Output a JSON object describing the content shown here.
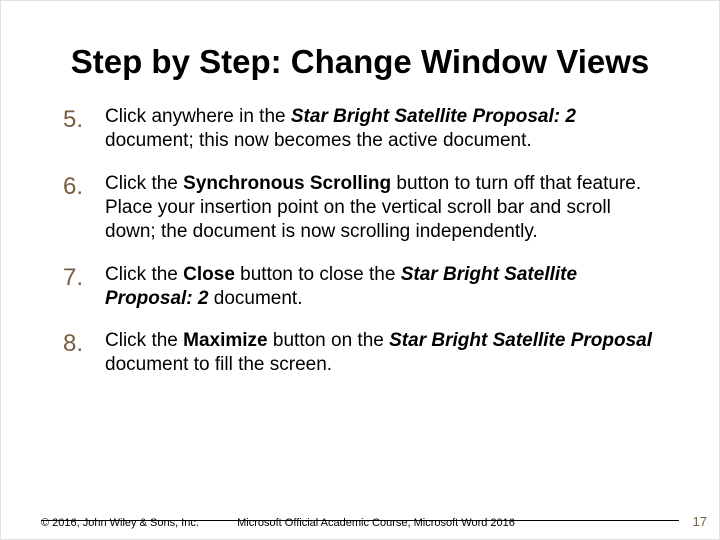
{
  "title": "Step by Step: Change Window Views",
  "steps": [
    {
      "num": "5.",
      "segments": [
        {
          "t": "Click anywhere in the "
        },
        {
          "t": "Star Bright Satellite Proposal: 2",
          "cls": "bolditalic"
        },
        {
          "t": " document; this now becomes the active document."
        }
      ]
    },
    {
      "num": "6.",
      "segments": [
        {
          "t": "Click the "
        },
        {
          "t": "Synchronous Scrolling",
          "cls": "bold"
        },
        {
          "t": " button to turn off that feature. Place your insertion point on the vertical scroll bar and scroll down; the document is now scrolling independently."
        }
      ]
    },
    {
      "num": "7.",
      "segments": [
        {
          "t": "Click the "
        },
        {
          "t": "Close",
          "cls": "bold"
        },
        {
          "t": " button to close the "
        },
        {
          "t": "Star Bright Satellite Proposal: 2",
          "cls": "bolditalic"
        },
        {
          "t": " document."
        }
      ]
    },
    {
      "num": "8.",
      "segments": [
        {
          "t": "Click the "
        },
        {
          "t": "Maximize",
          "cls": "bold"
        },
        {
          "t": " button on the "
        },
        {
          "t": "Star Bright Satellite Proposal",
          "cls": "bolditalic"
        },
        {
          "t": " document to fill the screen."
        }
      ]
    }
  ],
  "footer": {
    "copyright": "© 2016, John Wiley & Sons, Inc.",
    "center": "Microsoft Official Academic Course, Microsoft Word 2016",
    "pagenum": "17"
  }
}
